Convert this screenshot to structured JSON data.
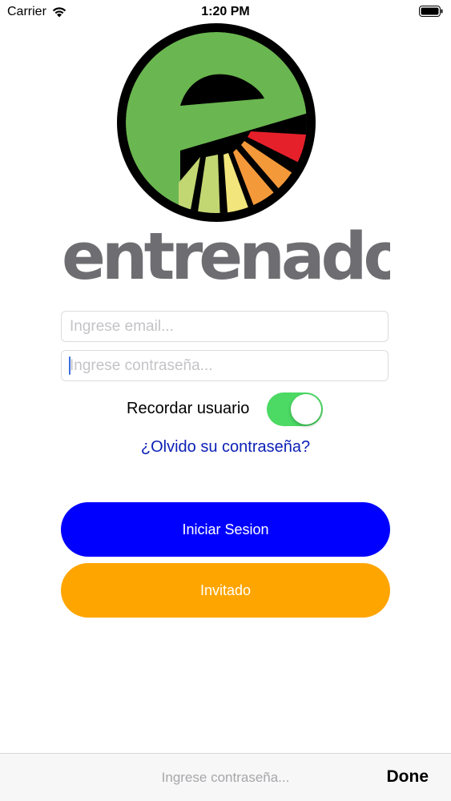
{
  "status_bar": {
    "carrier": "Carrier",
    "time": "1:20 PM",
    "wifi_icon": "wifi-icon",
    "battery_icon": "battery-icon"
  },
  "logo": {
    "icon": "entrenador-logo-icon",
    "wordmark": "entrenador",
    "colors": {
      "green": "#6ab650",
      "red": "#e5202a",
      "orange": "#f4993a",
      "yellow": "#f1e57b",
      "lightgreen": "#c2d672",
      "gray": "#6e6d71"
    }
  },
  "form": {
    "email_placeholder": "Ingrese email...",
    "email_value": "",
    "password_placeholder": "Ingrese contraseña...",
    "password_value": "",
    "remember_label": "Recordar usuario",
    "remember_on": true,
    "forgot_link": "¿Olvido su contraseña?"
  },
  "buttons": {
    "login_label": "Iniciar Sesion",
    "guest_label": "Invitado",
    "login_color": "#0000ff",
    "guest_color": "#ffa500"
  },
  "accessory": {
    "placeholder": "Ingrese contraseña...",
    "done_label": "Done"
  }
}
